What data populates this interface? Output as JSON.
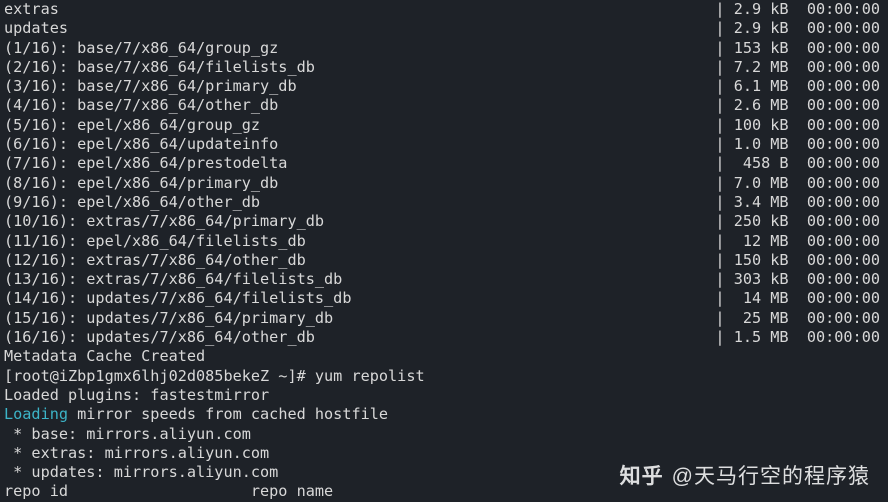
{
  "pre_rows": [
    {
      "lhs": "extras",
      "rhs": "| 2.9 kB  00:00:00"
    },
    {
      "lhs": "updates",
      "rhs": "| 2.9 kB  00:00:00"
    }
  ],
  "dl_rows": [
    {
      "lhs": "(1/16): base/7/x86_64/group_gz",
      "rhs": "| 153 kB  00:00:00"
    },
    {
      "lhs": "(2/16): base/7/x86_64/filelists_db",
      "rhs": "| 7.2 MB  00:00:00"
    },
    {
      "lhs": "(3/16): base/7/x86_64/primary_db",
      "rhs": "| 6.1 MB  00:00:00"
    },
    {
      "lhs": "(4/16): base/7/x86_64/other_db",
      "rhs": "| 2.6 MB  00:00:00"
    },
    {
      "lhs": "(5/16): epel/x86_64/group_gz",
      "rhs": "| 100 kB  00:00:00"
    },
    {
      "lhs": "(6/16): epel/x86_64/updateinfo",
      "rhs": "| 1.0 MB  00:00:00"
    },
    {
      "lhs": "(7/16): epel/x86_64/prestodelta",
      "rhs": "|  458 B  00:00:00"
    },
    {
      "lhs": "(8/16): epel/x86_64/primary_db",
      "rhs": "| 7.0 MB  00:00:00"
    },
    {
      "lhs": "(9/16): epel/x86_64/other_db",
      "rhs": "| 3.4 MB  00:00:00"
    },
    {
      "lhs": "(10/16): extras/7/x86_64/primary_db",
      "rhs": "| 250 kB  00:00:00"
    },
    {
      "lhs": "(11/16): epel/x86_64/filelists_db",
      "rhs": "|  12 MB  00:00:00"
    },
    {
      "lhs": "(12/16): extras/7/x86_64/other_db",
      "rhs": "| 150 kB  00:00:00"
    },
    {
      "lhs": "(13/16): extras/7/x86_64/filelists_db",
      "rhs": "| 303 kB  00:00:00"
    },
    {
      "lhs": "(14/16): updates/7/x86_64/filelists_db",
      "rhs": "|  14 MB  00:00:00"
    },
    {
      "lhs": "(15/16): updates/7/x86_64/primary_db",
      "rhs": "|  25 MB  00:00:00"
    },
    {
      "lhs": "(16/16): updates/7/x86_64/other_db",
      "rhs": "| 1.5 MB  00:00:00"
    }
  ],
  "lines": {
    "metadata_done": "Metadata Cache Created",
    "prompt": "[root@iZbp1gmx6lhj02d085bekeZ ~]# ",
    "command": "yum repolist",
    "plugins": "Loaded plugins: fastestmirror",
    "loading_word": "Loading",
    "loading_rest": " mirror speeds from cached hostfile",
    "mirror1": " * base: mirrors.aliyun.com",
    "mirror2": " * extras: mirrors.aliyun.com",
    "mirror3": " * updates: mirrors.aliyun.com",
    "footer_hint": "repo id                    repo name"
  },
  "watermark": {
    "site": "知乎",
    "author": "@天马行空的程序猿"
  }
}
